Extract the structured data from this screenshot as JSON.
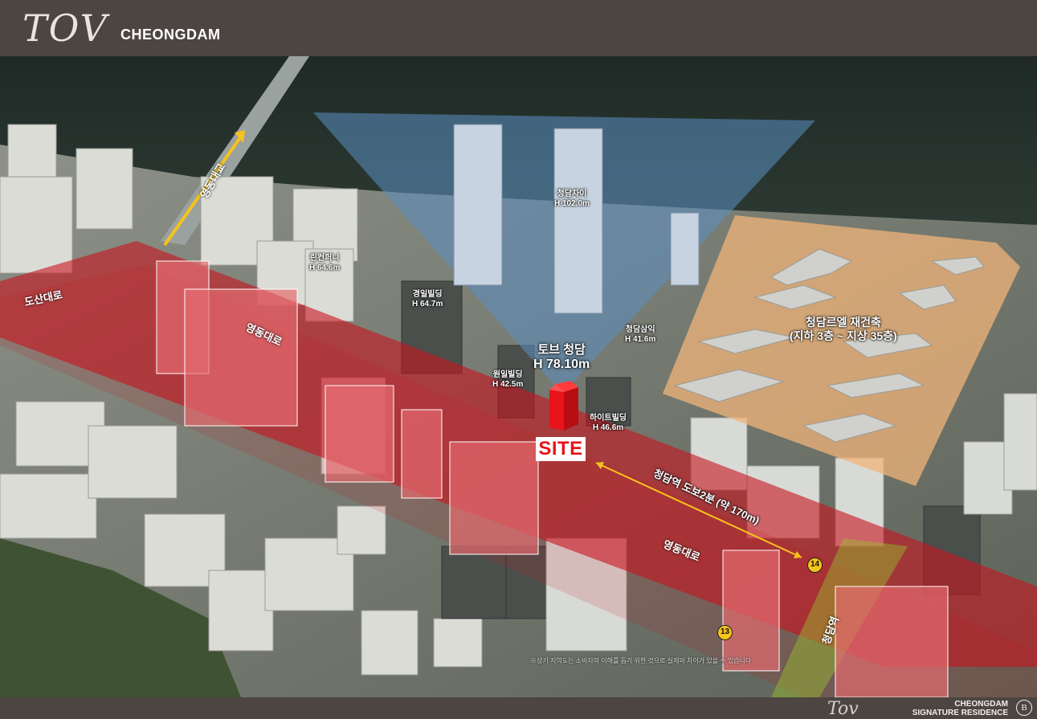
{
  "header": {
    "logo_script": "TOV",
    "logo_sub": "CHEONGDAM"
  },
  "footer": {
    "logo_script": "Tov",
    "line1": "CHEONGDAM",
    "line2": "SIGNATURE RESIDENCE",
    "emblem": "B"
  },
  "map": {
    "site": {
      "name": "토브 청담",
      "height": "H 78.10m",
      "tag": "SITE"
    },
    "buildings": [
      {
        "name": "청담자이",
        "height": "H 102.0m"
      },
      {
        "name": "린컨퍼니",
        "height": "H 64.6m"
      },
      {
        "name": "경일빌딩",
        "height": "H 64.7m"
      },
      {
        "name": "청담삼익",
        "height": "H 41.6m"
      },
      {
        "name": "원일빌딩",
        "height": "H 42.5m"
      },
      {
        "name": "하이트빌딩",
        "height": "H 46.6m"
      }
    ],
    "redevelopment": {
      "line1": "청담르엘 재건축",
      "line2": "(지하 3층 ~ 지상 35층)"
    },
    "roads": {
      "dosan": "도산대로",
      "yeongdong_upper": "영동대로",
      "yeongdong_lower": "영동대로",
      "bridge": "영동대교",
      "cheongdam": "청담역"
    },
    "walk_label": "청담역 도보2분 (약 170m)",
    "stations": [
      "13",
      "14"
    ],
    "disclaimer": "※상기 지역도는 소비자의 이해를 돕기 위한 것으로 실제와 차이가 있을 수 있습니다."
  },
  "colors": {
    "road_red": "#c8141e",
    "view_cone": "#5b8fc2",
    "redevelopment_zone": "#f0b47a",
    "station": "#f6c31b",
    "site_marker": "#e8141a"
  }
}
